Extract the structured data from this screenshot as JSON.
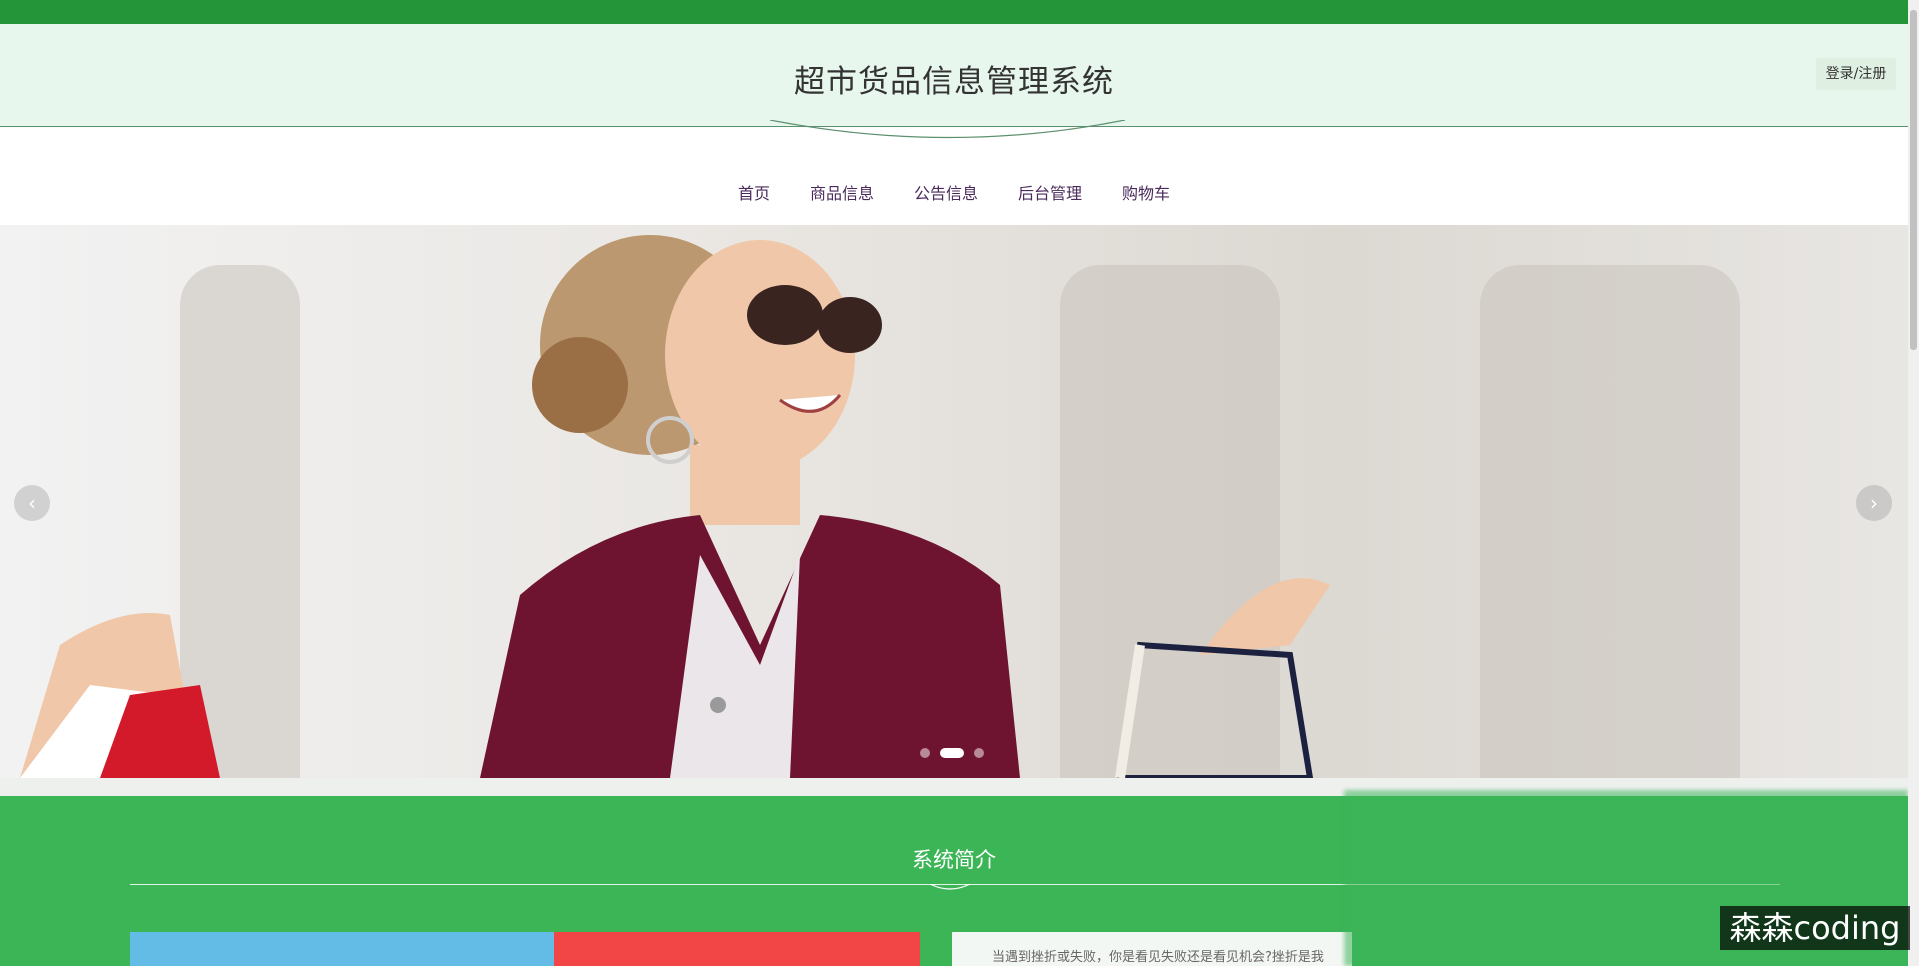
{
  "header": {
    "site_title": "超市货品信息管理系统",
    "login_label": "登录/注册"
  },
  "nav": {
    "items": [
      {
        "label": "首页",
        "active": true
      },
      {
        "label": "商品信息",
        "active": false
      },
      {
        "label": "公告信息",
        "active": false
      },
      {
        "label": "后台管理",
        "active": false
      },
      {
        "label": "购物车",
        "active": false
      }
    ]
  },
  "banner": {
    "prev_icon": "‹",
    "next_icon": "›",
    "slide_count": 3,
    "active_slide": 2
  },
  "intro": {
    "title": "系统简介",
    "text": "当遇到挫折或失败，你是看见失败还是看见机会?挫折是我"
  },
  "watermark": "森森coding",
  "colors": {
    "brand_green": "#25953a",
    "intro_green": "#3bb556",
    "header_bg": "#e8f7ee",
    "nav_text": "#4a2a5c",
    "block_blue": "#62bce6",
    "block_red": "#f24545"
  }
}
